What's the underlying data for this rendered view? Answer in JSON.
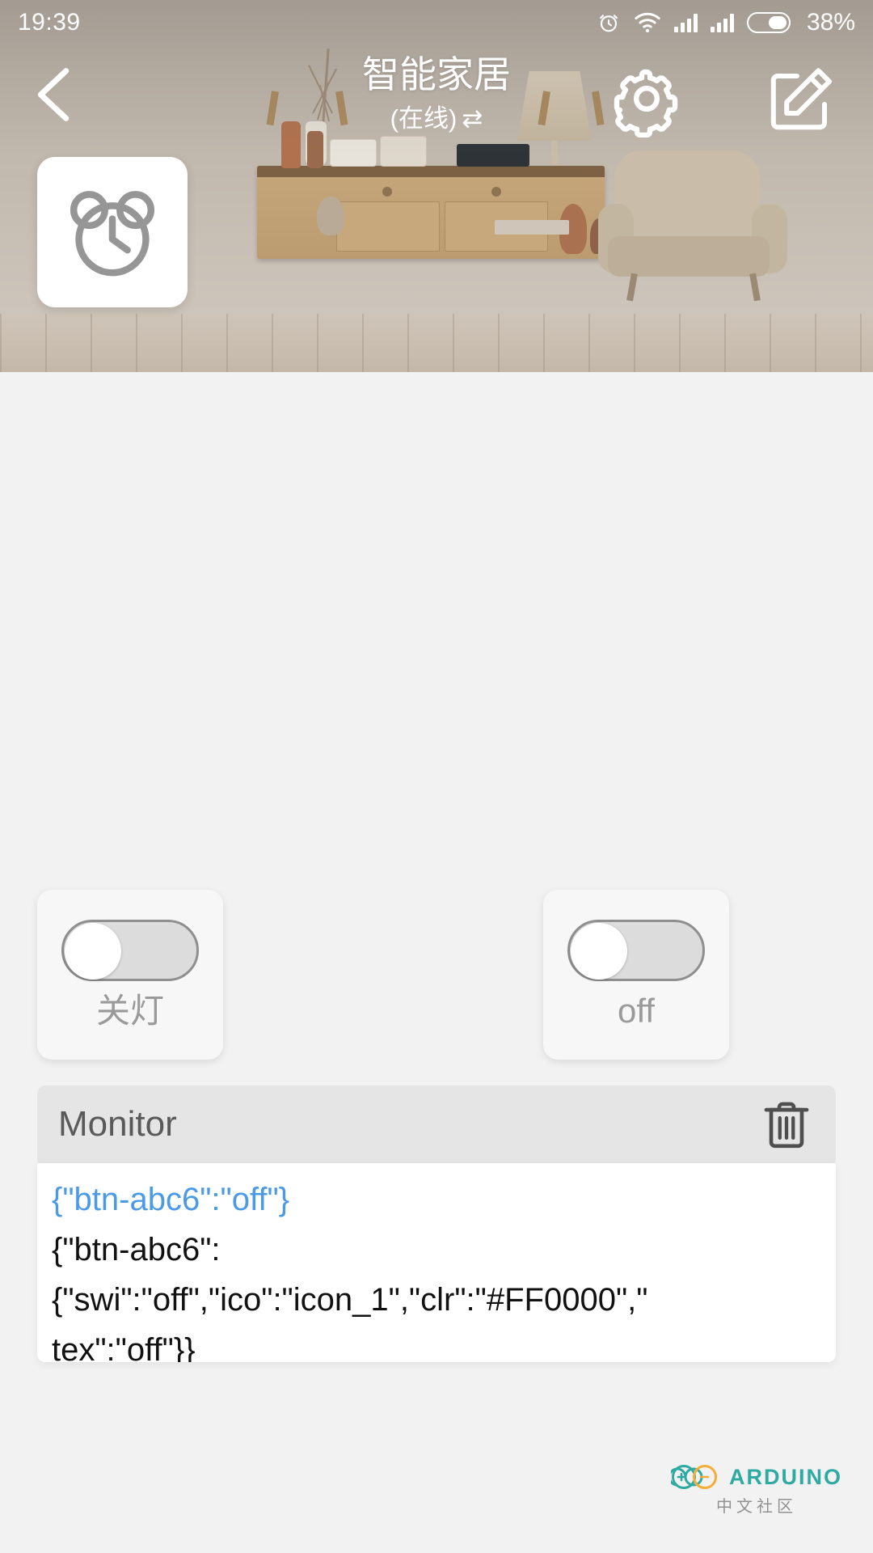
{
  "status_bar": {
    "time": "19:39",
    "battery_percent": "38%",
    "icons": [
      "alarm-icon",
      "wifi-icon",
      "signal-icon",
      "signal-icon",
      "battery-icon"
    ]
  },
  "header": {
    "back_icon": "chevron-left-icon",
    "title": "智能家居",
    "subtitle": "(在线)",
    "subtitle_suffix": "⇄",
    "settings_icon": "gear-icon",
    "edit_icon": "edit-pencil-icon"
  },
  "alarm_card": {
    "icon": "alarm-clock-icon"
  },
  "switches": [
    {
      "id": "switch-left",
      "label": "关灯",
      "state": "off",
      "icon": "toggle-switch-icon"
    },
    {
      "id": "switch-right",
      "label": "off",
      "state": "off",
      "icon": "toggle-switch-icon"
    }
  ],
  "monitor": {
    "title": "Monitor",
    "clear_icon": "trash-icon",
    "sent_color": "#4a9ae8",
    "lines": [
      {
        "text": "{\"btn-abc6\":\"off\"}",
        "type": "sent"
      },
      {
        "text": "{\"btn-abc6\":",
        "type": "received"
      },
      {
        "text": "{\"swi\":\"off\",\"ico\":\"icon_1\",\"clr\":\"#FF0000\",\"",
        "type": "received"
      },
      {
        "text": "tex\":\"off\"}}",
        "type": "received"
      }
    ]
  },
  "watermark": {
    "brand": "ARDUINO",
    "sub": "中文社区",
    "logo_icon": "arduino-infinity-icon"
  }
}
